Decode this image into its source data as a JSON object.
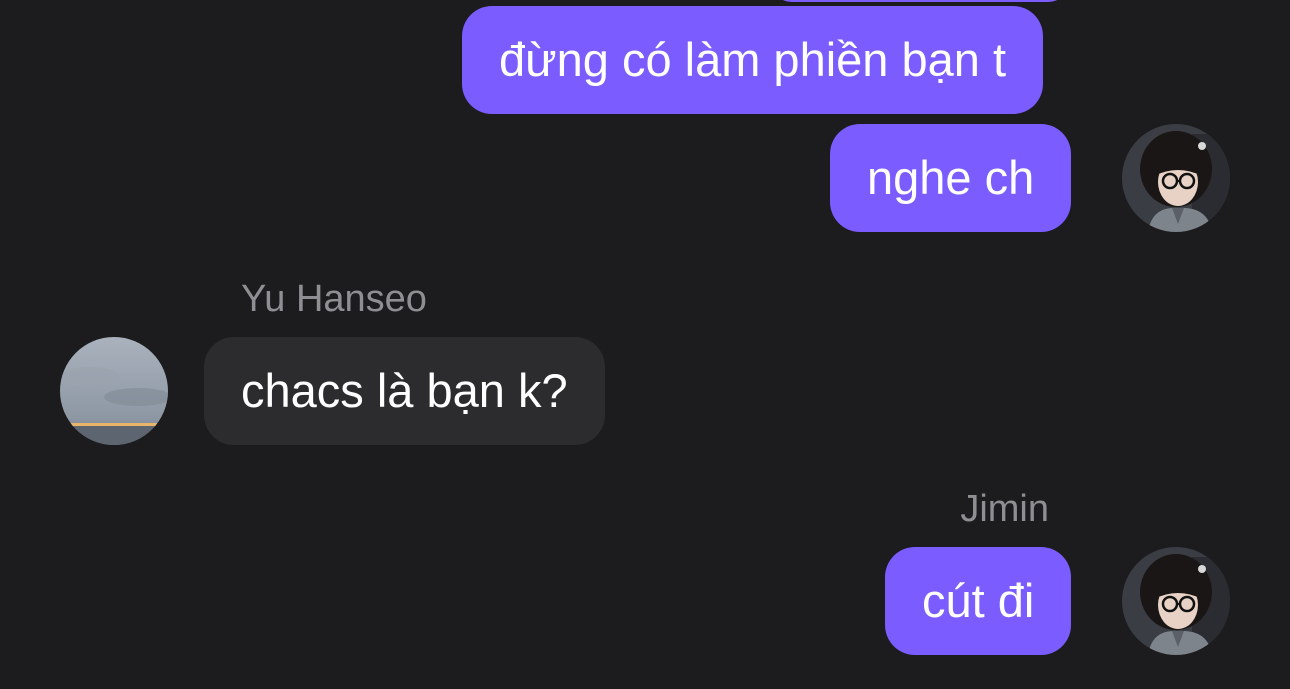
{
  "conversation": {
    "messages": [
      {
        "sender": "",
        "text": "đừng có làm phiền bạn t",
        "outgoing": true
      },
      {
        "sender": "",
        "text": "nghe ch",
        "outgoing": true
      },
      {
        "sender": "Yu Hanseo",
        "text": "chacs là bạn k?",
        "outgoing": false
      },
      {
        "sender": "Jimin",
        "text": "cút đi",
        "outgoing": true
      }
    ]
  },
  "colors": {
    "background": "#1c1c1e",
    "outgoing_bubble": "#7b5cff",
    "incoming_bubble": "#2c2c2e",
    "sender_name": "#8e8e93",
    "message_text": "#ffffff"
  },
  "icons": {
    "jimin_avatar": "jimin-avatar",
    "yu_hanseo_avatar": "yu-hanseo-avatar"
  }
}
